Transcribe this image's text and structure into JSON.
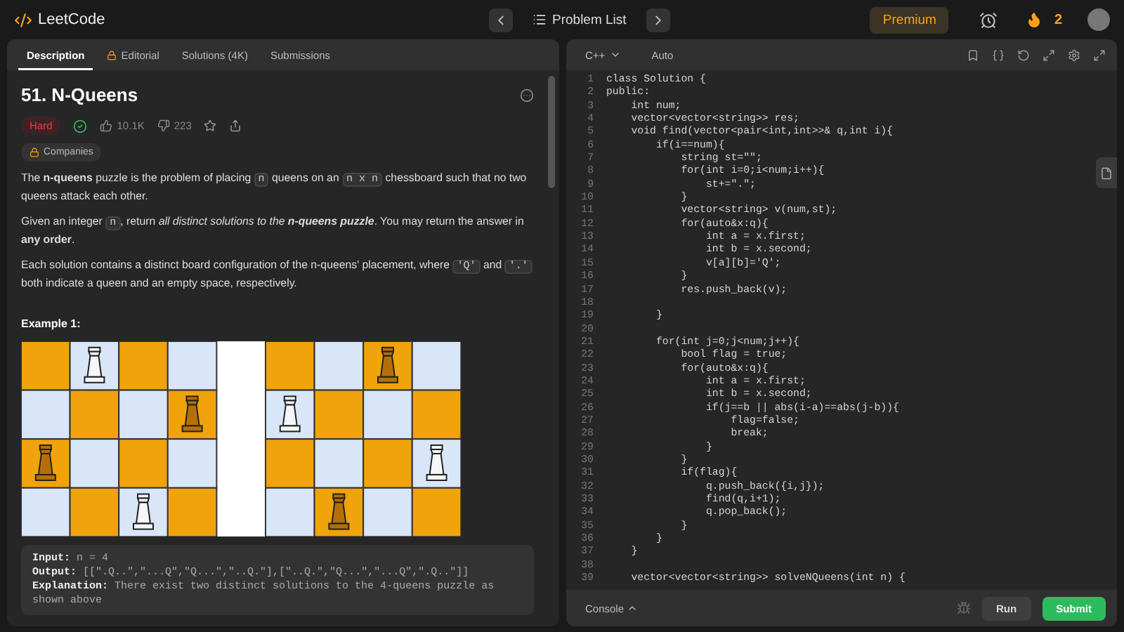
{
  "nav": {
    "logo": "LeetCode",
    "problem_list": "Problem List",
    "premium": "Premium",
    "streak": "2"
  },
  "left": {
    "tabs": [
      {
        "label": "Description",
        "selected": true,
        "locked": false
      },
      {
        "label": "Editorial",
        "selected": false,
        "locked": true
      },
      {
        "label": "Solutions (4K)",
        "selected": false,
        "locked": false
      },
      {
        "label": "Submissions",
        "selected": false,
        "locked": false
      }
    ],
    "problem": {
      "title": "51. N-Queens",
      "difficulty": "Hard",
      "solved": true,
      "likes": "10.1K",
      "dislikes": "223",
      "companies": "Companies"
    },
    "description": [
      [
        {
          "kind": "text",
          "text": "The **n-queens** puzzle is the problem of placing "
        },
        {
          "kind": "code",
          "text": "n"
        },
        {
          "kind": "text",
          "text": " queens on an "
        },
        {
          "kind": "code",
          "text": "n x n"
        },
        {
          "kind": "text",
          "text": " chessboard such that no two queens attack each other."
        }
      ],
      [
        {
          "kind": "text",
          "text": "Given an integer "
        },
        {
          "kind": "code",
          "text": "n"
        },
        {
          "kind": "text",
          "text": ", return "
        },
        {
          "kind": "italic",
          "text": "all distinct solutions to the **n-queens puzzle**"
        },
        {
          "kind": "text",
          "text": ". You may return the answer in **any order**."
        }
      ],
      [
        {
          "kind": "text",
          "text": "Each solution contains a distinct board configuration of the n-queens' placement, where "
        },
        {
          "kind": "code",
          "text": "'Q'"
        },
        {
          "kind": "text",
          "text": " and "
        },
        {
          "kind": "code",
          "text": "'.'"
        },
        {
          "kind": "text",
          "text": " both indicate a queen and an empty space, respectively."
        }
      ]
    ],
    "example": {
      "heading": "Example 1:",
      "lines": [
        {
          "label": "Input:",
          "value": "n = 4"
        },
        {
          "label": "Output:",
          "value": "[[\".Q..\",\"...Q\",\"Q...\",\"..Q.\"],[\"..Q.\",\"Q...\",\"...Q\",\".Q..\"]]"
        },
        {
          "label": "Explanation:",
          "value": "There exist two distinct solutions to the 4-queens puzzle as shown above"
        }
      ]
    }
  },
  "editor": {
    "language": "C++",
    "mode": "Auto",
    "lines": [
      {
        "number": "1",
        "code": "class Solution {"
      },
      {
        "number": "2",
        "code": "public:"
      },
      {
        "number": "3",
        "code": "    int num;"
      },
      {
        "number": "4",
        "code": "    vector<vector<string>> res;"
      },
      {
        "number": "5",
        "code": "    void find(vector<pair<int,int>>& q,int i){"
      },
      {
        "number": "6",
        "code": "        if(i==num){"
      },
      {
        "number": "7",
        "code": "            string st=\"\";"
      },
      {
        "number": "8",
        "code": "            for(int i=0;i<num;i++){"
      },
      {
        "number": "9",
        "code": "                st+=\".\";"
      },
      {
        "number": "10",
        "code": "            }"
      },
      {
        "number": "11",
        "code": "            vector<string> v(num,st);"
      },
      {
        "number": "12",
        "code": "            for(auto&x:q){"
      },
      {
        "number": "13",
        "code": "                int a = x.first;"
      },
      {
        "number": "14",
        "code": "                int b = x.second;"
      },
      {
        "number": "15",
        "code": "                v[a][b]='Q';"
      },
      {
        "number": "16",
        "code": "            }"
      },
      {
        "number": "17",
        "code": "            res.push_back(v);"
      },
      {
        "number": "18"
      },
      {
        "number": "19",
        "code": "        }"
      },
      {
        "number": "20"
      },
      {
        "number": "21",
        "code": "        for(int j=0;j<num;j++){"
      },
      {
        "number": "22",
        "code": "            bool flag = true;"
      },
      {
        "number": "23",
        "code": "            for(auto&x:q){"
      },
      {
        "number": "24",
        "code": "                int a = x.first;"
      },
      {
        "number": "25",
        "code": "                int b = x.second;"
      },
      {
        "number": "26",
        "code": "                if(j==b || abs(i-a)==abs(j-b)){"
      },
      {
        "number": "27",
        "code": "                    flag=false;"
      },
      {
        "number": "28",
        "code": "                    break;"
      },
      {
        "number": "29",
        "code": "                }"
      },
      {
        "number": "30",
        "code": "            }"
      },
      {
        "number": "31",
        "code": "            if(flag){"
      },
      {
        "number": "32",
        "code": "                q.push_back({i,j});"
      },
      {
        "number": "33",
        "code": "                find(q,i+1);"
      },
      {
        "number": "34",
        "code": "                q.pop_back();"
      },
      {
        "number": "35",
        "code": "            }"
      },
      {
        "number": "36",
        "code": "        }"
      },
      {
        "number": "37",
        "code": "    }"
      },
      {
        "number": "38"
      },
      {
        "number": "39",
        "code": "    vector<vector<string>> solveNQueens(int n) {"
      }
    ],
    "console": "Console",
    "run": "Run",
    "submit": "Submit"
  }
}
